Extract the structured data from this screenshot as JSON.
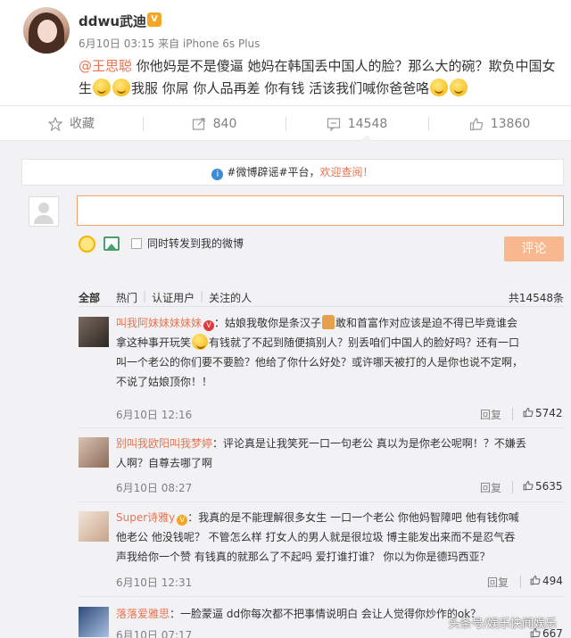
{
  "post": {
    "username": "ddwu武迪",
    "meta": "6月10日 03:15 来自 iPhone 6s Plus",
    "mention": "@王思聪",
    "text_line1": " 你他妈是不是傻逼 她妈在韩国丢中国人的脸？那么大的碗？欺负中国女",
    "text_line2_a": "生",
    "text_line2_b": "我服 你屌 你人品再差 你有钱 活该我们喊你爸爸咯"
  },
  "actions": {
    "favorite": "收藏",
    "forward_count": "840",
    "comment_count": "14548",
    "like_count": "13860"
  },
  "notice": {
    "prefix": "#微博辟谣#平台，",
    "link": "欢迎查阅！"
  },
  "composer": {
    "input_value": "",
    "forward_label": "同时转发到我的微博",
    "submit_label": "评论"
  },
  "tabs": {
    "all": "全部",
    "hot": "热门",
    "verified": "认证用户",
    "following": "关注的人",
    "total": "共14548条"
  },
  "comments": [
    {
      "name": "叫我阿妹妹妹妹妹",
      "text_a": "：姑娘我敬你是条汉子",
      "text_b": "敢和首富作对应该是迫不得已毕竟谁会",
      "line2_a": "拿这种事开玩笑",
      "line2_b": "有钱就了不起到随便搞别人？别丢咱们中国人的脸好吗？还有一口",
      "line3": "叫一个老公的你们要不要脸？他给了你什么好处？或许哪天被打的人是你也说不定啊，",
      "line4": "不说了姑娘顶你！！",
      "time": "6月10日 12:16",
      "reply": "回复",
      "likes": "5742"
    },
    {
      "name": "别叫我欧阳叫我梦婷",
      "line1": "：评论真是让我笑死一口一句老公 真以为是你老公呢啊！？不嫌丢",
      "line2": "人啊？自尊去哪了啊",
      "time": "6月10日 08:27",
      "reply": "回复",
      "likes": "5635"
    },
    {
      "name": "Super诗雅y",
      "line1": "：我真的是不能理解很多女生 一口一个老公 你他妈智障吧 他有钱你喊",
      "line2": "他老公 他没钱呢？ 不管怎么样 打女人的男人就是很垃圾  博主能发出来而不是忍气吞",
      "line3": "声我给你一个赞  有钱真的就那么了不起吗 爱打谁打谁？ 你以为你是德玛西亚？",
      "time": "6月10日 12:31",
      "reply": "回复",
      "likes": "494"
    },
    {
      "name": "落落爱雅思",
      "line1": "：一脸蒙逼 dd你每次都不把事情说明白 会让人觉得你炒作的ok？",
      "time": "6月10日 07:17",
      "likes": "667"
    }
  ],
  "watermark": "头条号/娱乐快闻娱乐",
  "colors": {
    "accent": "#eb7350",
    "panel_bg": "#f2f2f5",
    "meta_gray": "#808080"
  }
}
